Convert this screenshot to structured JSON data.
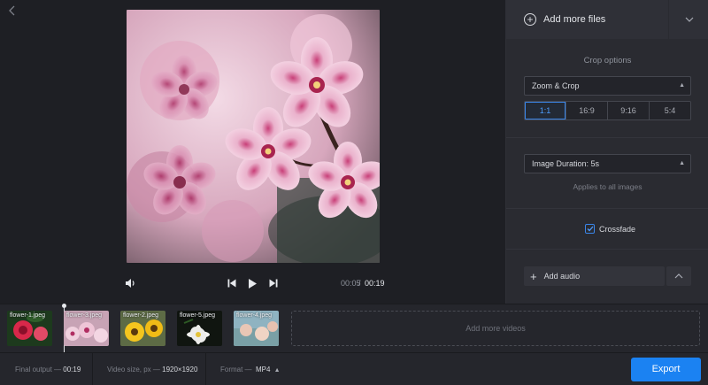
{
  "preview": {
    "back_icon": "chevron-left-icon",
    "time_current": "00:05",
    "time_separator": "/",
    "time_total": "00:19"
  },
  "panel": {
    "add_files_label": "Add more files",
    "crop": {
      "title": "Crop options",
      "mode_value": "Zoom & Crop",
      "ratios": [
        "1:1",
        "16:9",
        "9:16",
        "5:4"
      ],
      "active_ratio": "1:1"
    },
    "duration": {
      "value": "Image Duration: 5s",
      "note": "Applies to all images"
    },
    "crossfade": {
      "label": "Crossfade",
      "checked": true
    },
    "audio": {
      "add_label": "Add audio"
    }
  },
  "timeline": {
    "clips": [
      {
        "label": "flower-1.jpeg"
      },
      {
        "label": "flower-3.jpeg"
      },
      {
        "label": "flower-2.jpeg"
      },
      {
        "label": "flower-5.jpeg"
      },
      {
        "label": "flower-4.jpeg"
      }
    ],
    "add_more_label": "Add more videos"
  },
  "bottombar": {
    "final_output_label": "Final output —",
    "final_output_value": "00:19",
    "video_size_label": "Video size, px —",
    "video_size_value": "1920×1920",
    "format_label": "Format —",
    "format_value": "MP4",
    "export_label": "Export"
  },
  "colors": {
    "accent": "#1b82f2",
    "background": "#1e1f24",
    "panel": "#2a2b31"
  }
}
